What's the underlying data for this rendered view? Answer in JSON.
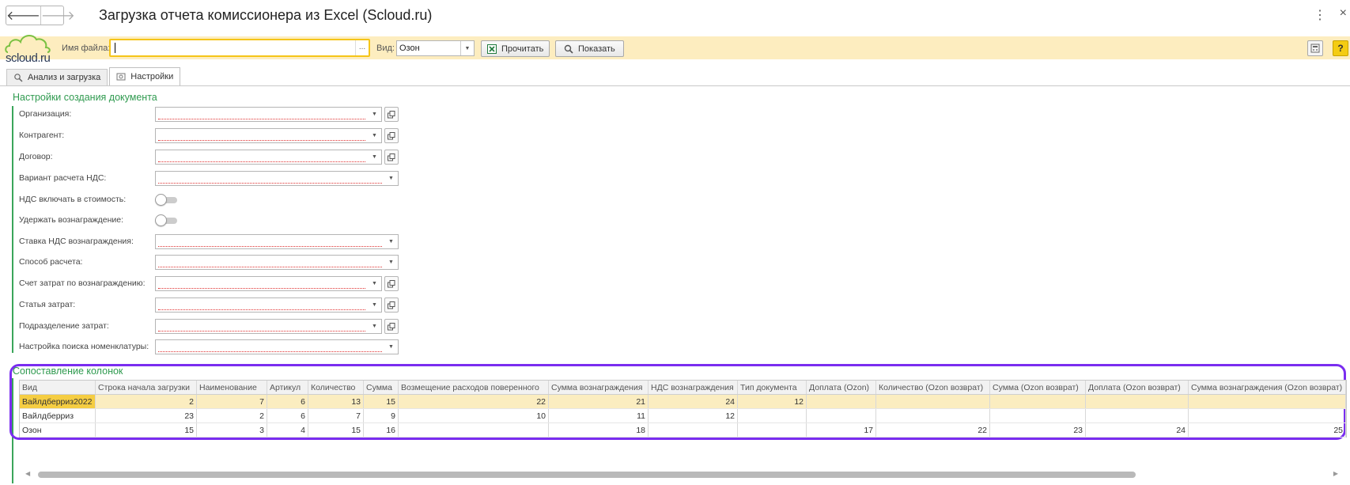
{
  "window": {
    "title": "Загрузка отчета комиссионера из Excel (Scloud.ru)",
    "back_label": "🡐",
    "forward_label": "🡒",
    "menu_label": "⋮",
    "close_label": "×"
  },
  "logo": {
    "text": "scloud.ru",
    "color": "#7bc143"
  },
  "toolbar": {
    "file_label": "Имя файла:",
    "file_value": "",
    "file_dots": "...",
    "vid_label": "Вид:",
    "vid_value": "Озон",
    "read_button": "Прочитать",
    "show_button": "Показать",
    "help_label": "?"
  },
  "tabs": [
    {
      "label": "Анализ и загрузка",
      "active": false
    },
    {
      "label": "Настройки",
      "active": true
    }
  ],
  "settings": {
    "title": "Настройки создания документа",
    "fields": [
      {
        "label": "Организация:",
        "type": "ref"
      },
      {
        "label": "Контрагент:",
        "type": "ref"
      },
      {
        "label": "Договор:",
        "type": "ref"
      },
      {
        "label": "Вариант расчета НДС:",
        "type": "select"
      },
      {
        "label": "НДС включать в стоимость:",
        "type": "toggle",
        "on": false
      },
      {
        "label": "Удержать вознаграждение:",
        "type": "toggle",
        "on": false
      },
      {
        "label": "Ставка НДС вознаграждения:",
        "type": "select"
      },
      {
        "label": "Способ расчета:",
        "type": "select"
      },
      {
        "label": "Счет затрат по вознаграждению:",
        "type": "ref"
      },
      {
        "label": "Статья затрат:",
        "type": "ref"
      },
      {
        "label": "Подразделение затрат:",
        "type": "ref"
      },
      {
        "label": "Настройка поиска номенклатуры:",
        "type": "select"
      }
    ]
  },
  "mapping": {
    "title": "Сопоставление колонок",
    "columns": [
      "Вид",
      "Строка начала загрузки",
      "Наименование",
      "Артикул",
      "Количество",
      "Сумма",
      "Возмещение расходов поверенного",
      "Сумма вознаграждения",
      "НДС вознаграждения",
      "Тип документа",
      "Доплата (Ozon)",
      "Количество (Ozon возврат)",
      "Сумма (Ozon возврат)",
      "Доплата (Ozon возврат)",
      "Сумма вознаграждения (Ozon возврат)"
    ],
    "rows": [
      [
        "Вайлдберриз2022",
        "2",
        "7",
        "6",
        "13",
        "15",
        "22",
        "21",
        "24",
        "12",
        "",
        "",
        "",
        "",
        ""
      ],
      [
        "Вайлдберриз",
        "23",
        "2",
        "6",
        "7",
        "9",
        "10",
        "11",
        "12",
        "",
        "",
        "",
        "",
        "",
        ""
      ],
      [
        "Озон",
        "15",
        "3",
        "4",
        "15",
        "16",
        "",
        "18",
        "",
        "",
        "17",
        "22",
        "23",
        "24",
        "25"
      ]
    ],
    "selected_row": 0
  },
  "colors": {
    "accent_green": "#2f9a4f",
    "toolbar_bg": "#fdedbf",
    "highlight_frame": "#7a2df0",
    "selected_row": "#fbedc0",
    "help_yellow": "#f4cc13"
  }
}
